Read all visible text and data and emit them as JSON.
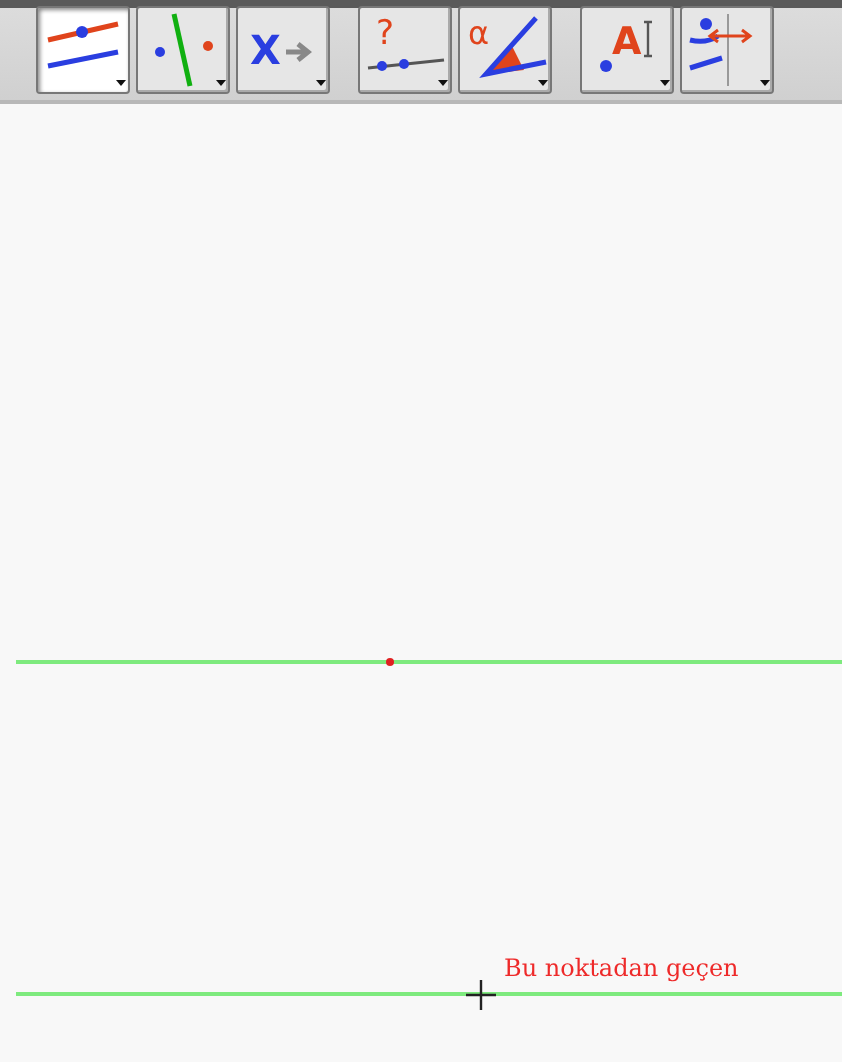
{
  "toolbar": {
    "groups": [
      {
        "tools": [
          {
            "kind": "parallel",
            "selected": true
          },
          {
            "kind": "perpendicular",
            "selected": false
          },
          {
            "kind": "transform",
            "glyph": "X",
            "selected": false
          }
        ]
      },
      {
        "tools": [
          {
            "kind": "relation",
            "glyph": "?",
            "selected": false
          },
          {
            "kind": "angle",
            "glyph": "α",
            "selected": false
          }
        ]
      },
      {
        "tools": [
          {
            "kind": "text",
            "glyph": "A",
            "selected": false
          },
          {
            "kind": "slider",
            "selected": false
          }
        ]
      }
    ]
  },
  "canvas": {
    "label": "Bu noktadan geçen"
  }
}
